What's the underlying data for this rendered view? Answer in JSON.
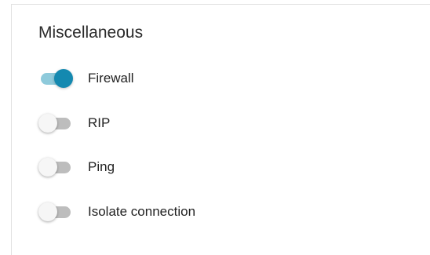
{
  "section": {
    "title": "Miscellaneous"
  },
  "toggles": [
    {
      "label": "Firewall",
      "enabled": true
    },
    {
      "label": "RIP",
      "enabled": false
    },
    {
      "label": "Ping",
      "enabled": false
    },
    {
      "label": "Isolate connection",
      "enabled": false
    }
  ],
  "colors": {
    "toggle_on_thumb": "#1489b0",
    "toggle_on_track": "#8ecadb",
    "toggle_off_thumb": "#f6f6f6",
    "toggle_off_track": "#bdbdbd"
  }
}
